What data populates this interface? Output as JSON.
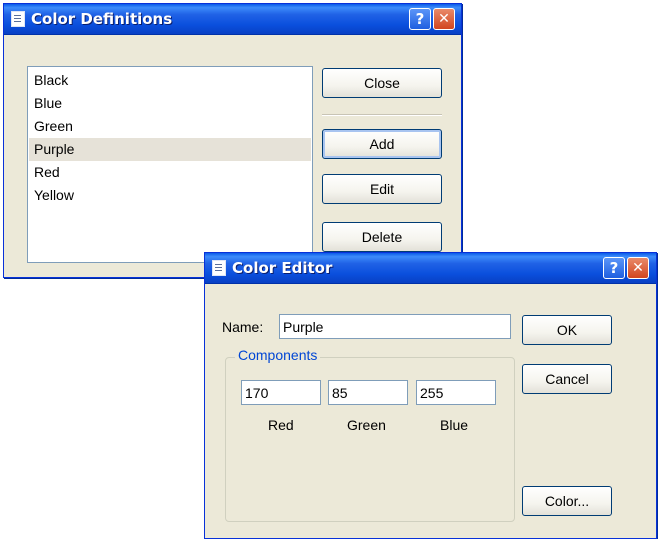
{
  "definitions_window": {
    "title": "Color Definitions",
    "help_glyph": "?",
    "close_glyph": "✕",
    "colors": [
      {
        "label": "Black"
      },
      {
        "label": "Blue"
      },
      {
        "label": "Green"
      },
      {
        "label": "Purple",
        "selected": true
      },
      {
        "label": "Red"
      },
      {
        "label": "Yellow"
      }
    ],
    "buttons": {
      "close": "Close",
      "add": "Add",
      "edit": "Edit",
      "delete": "Delete"
    }
  },
  "editor_window": {
    "title": "Color Editor",
    "help_glyph": "?",
    "close_glyph": "✕",
    "name_label": "Name:",
    "name_value": "Purple",
    "components_title": "Components",
    "components": {
      "red": {
        "value": "170",
        "label": "Red"
      },
      "green": {
        "value": "85",
        "label": "Green"
      },
      "blue": {
        "value": "255",
        "label": "Blue"
      }
    },
    "buttons": {
      "ok": "OK",
      "cancel": "Cancel",
      "color": "Color..."
    }
  },
  "icons": {
    "window_icon": "document-icon"
  },
  "colors": {
    "titlebar": "#2062e6",
    "dialog_face": "#ece9d8",
    "selection": "#e6e2d8",
    "group_title": "#0046d5",
    "close_button": "#d2451f"
  }
}
